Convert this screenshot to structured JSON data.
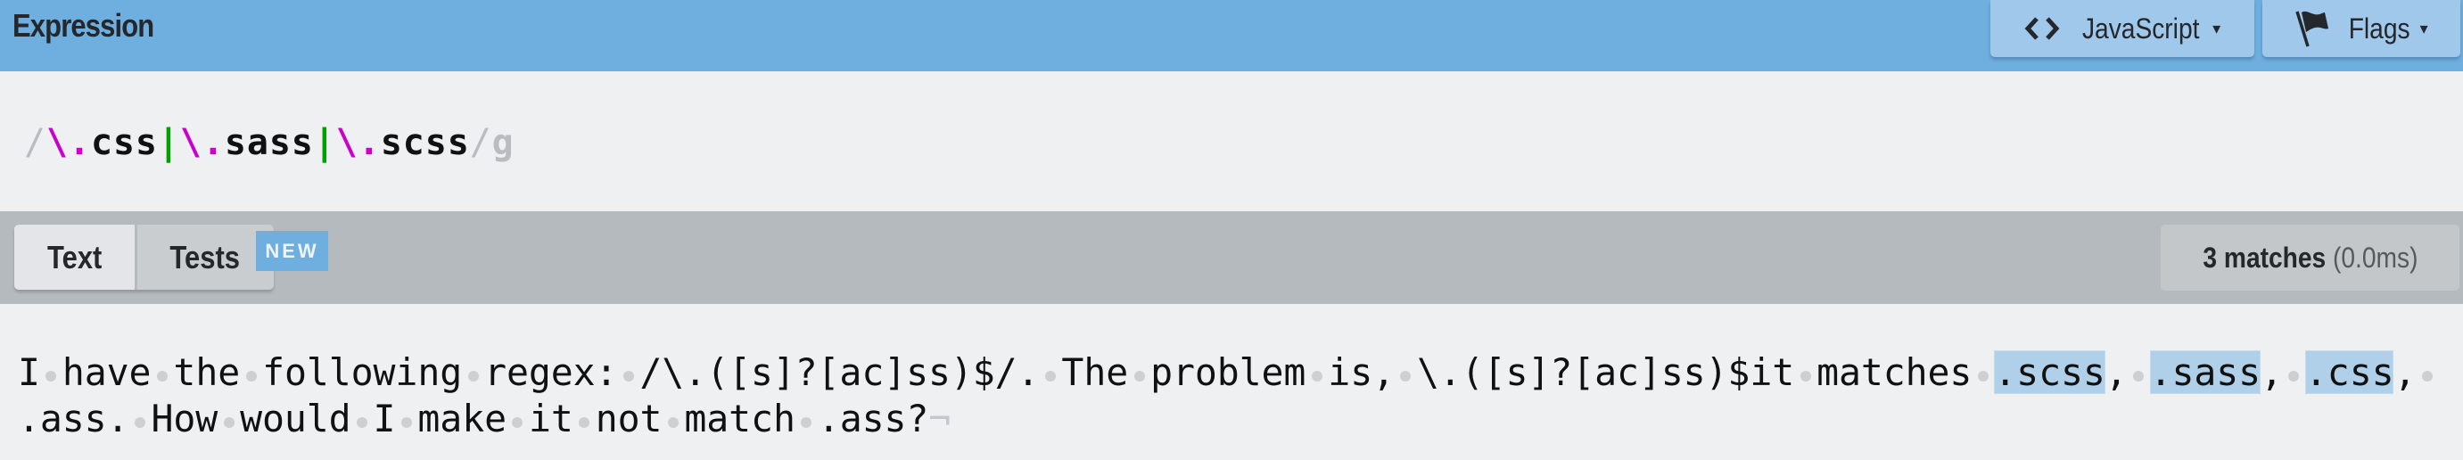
{
  "header": {
    "title": "Expression",
    "flavor_button": {
      "icon": "code-brackets-icon",
      "label": "JavaScript",
      "caret": "▾"
    },
    "flags_button": {
      "icon": "flag-icon",
      "label": "Flags",
      "caret": "▾"
    }
  },
  "expression": {
    "open_delimiter": "/",
    "tokens": [
      {
        "text": "\\.",
        "type": "escape"
      },
      {
        "text": "css",
        "type": "literal"
      },
      {
        "text": "|",
        "type": "alternation"
      },
      {
        "text": "\\.",
        "type": "escape"
      },
      {
        "text": "sass",
        "type": "literal"
      },
      {
        "text": "|",
        "type": "alternation"
      },
      {
        "text": "\\.",
        "type": "escape"
      },
      {
        "text": "scss",
        "type": "literal"
      }
    ],
    "close_delimiter": "/",
    "flags": "g"
  },
  "toolbar": {
    "tabs": [
      {
        "label": "Text",
        "active": true
      },
      {
        "label": "Tests",
        "active": false,
        "badge": "NEW"
      }
    ],
    "match_info": {
      "count_label": "3 matches",
      "time_label": "(0.0ms)"
    }
  },
  "test_text": {
    "content": "I have the following regex: /\\.([s]?[ac]ss)$/. The problem is, \\.([s]?[ac]ss)$it matches .scss, .sass, .css, .ass. How would I make it not match .ass?",
    "matches": [
      ".scss",
      ".sass",
      ".css"
    ],
    "end_of_line_marker": "¬"
  },
  "colors": {
    "header_bg": "#6eafdf",
    "escape": "#cc00cc",
    "alternation": "#00a000",
    "match_highlight": "#b0d0ea"
  }
}
